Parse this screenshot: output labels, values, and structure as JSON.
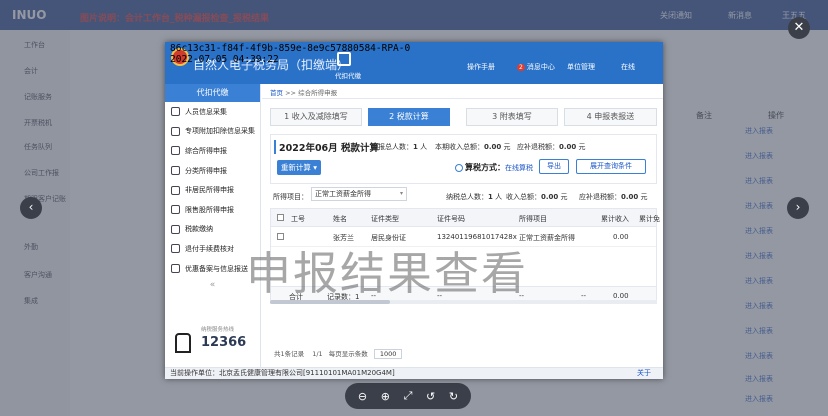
{
  "background": {
    "logo": "INUO",
    "caption": "图片说明：会计工作台_税种漏报检查_报税结果",
    "top_right": [
      "关闭通知",
      "新消息",
      "王五五"
    ],
    "sidebar": [
      "工作台",
      "会计",
      "记账服务",
      "开票税机",
      "任务队列",
      "公司工作报",
      "期限客户记账",
      "外勤",
      "客户沟通",
      "集成"
    ],
    "col_header": "备注",
    "op_header": "操作",
    "links": [
      "进入报表",
      "进入报表",
      "进入报表",
      "进入报表",
      "进入报表",
      "进入报表",
      "进入报表",
      "进入报表",
      "进入报表",
      "进入报表",
      "进入报表",
      "进入报表"
    ]
  },
  "viewer": {
    "close_glyph": "✕",
    "prev_glyph": "‹",
    "next_glyph": "›",
    "zoom_tools": [
      "⊖",
      "⊕",
      "⤢",
      "↺",
      "↻"
    ]
  },
  "overlay_text": {
    "line1": "86c13c31-f84f-4f9b-859e-8e9c57880584-RPA-0",
    "line2": "2022-07-05 04:39:22"
  },
  "header": {
    "title": "自然人电子税务局（扣缴端）",
    "agent_label": "代扣代缴",
    "items": [
      "操作手册",
      "消息中心",
      "单位管理",
      "在线"
    ],
    "message_badge": "2"
  },
  "left_panel": {
    "title": "代扣代缴",
    "items": [
      "人员信息采集",
      "专项附加扣除信息采集",
      "综合所得申报",
      "分类所得申报",
      "非居民所得申报",
      "限售股所得申报",
      "税款缴纳",
      "退付手续费核对",
      "优惠备案与信息报送"
    ],
    "collapse_glyph": "«",
    "hotline_label": "纳税服务热线",
    "hotline_number": "12366"
  },
  "breadcrumb": {
    "home": "首页",
    "sep": ">>",
    "current": "综合所得申报"
  },
  "steps": [
    "1 收入及减除填写",
    "2 税款计算",
    "3 附表填写",
    "4 申报表报送"
  ],
  "active_step": 1,
  "summary": {
    "title": "2022年06月  税款计算",
    "declare_count_label": "申报总人数：",
    "declare_count": "1",
    "declare_unit": "人",
    "income_label": "本期收入总额：",
    "income": "0.00",
    "income_unit": "元",
    "refund_label": "应补退税额：",
    "refund": "0.00",
    "refund_unit": "元",
    "recalc_button": "重新计算",
    "method_label": "算税方式：",
    "method_value": "在线算税",
    "export_button": "导出",
    "expand_button": "展开查询条件"
  },
  "filter": {
    "label": "所得项目：",
    "value": "正常工资薪金所得",
    "taxpayer_label": "纳税总人数：",
    "taxpayer_count": "1",
    "taxpayer_unit": "人",
    "income_label": "收入总额：",
    "income": "0.00",
    "income_unit": "元",
    "refund_label": "应补退税额：",
    "refund": "0.00",
    "refund_unit": "元"
  },
  "table": {
    "headers": [
      "工号",
      "姓名",
      "证件类型",
      "证件号码",
      "所得项目",
      "累计收入",
      "累计免"
    ],
    "rows": [
      {
        "id": "",
        "name": "张芳兰",
        "id_type": "居民身份证",
        "id_number": "13240119681017428x",
        "item": "正常工资薪金所得",
        "income": "0.00"
      }
    ],
    "footer": {
      "label": "合计",
      "count": "记录数：1",
      "dash1": "--",
      "dash2": "--",
      "dash3": "--",
      "dash4": "--",
      "total": "0.00"
    }
  },
  "pager": {
    "text": "共1条记录",
    "pages": "1/1",
    "per_page": "每页显示条数",
    "size": "1000"
  },
  "footer": {
    "label": "当前操作单位：北京孟氏健康管理有限公司[91110101MA01M20G4M]",
    "link": "关于"
  },
  "watermark": "申报结果查看",
  "colors": {
    "primary": "#3a80d4",
    "header": "#2a72c8",
    "link": "#1a56c8"
  }
}
